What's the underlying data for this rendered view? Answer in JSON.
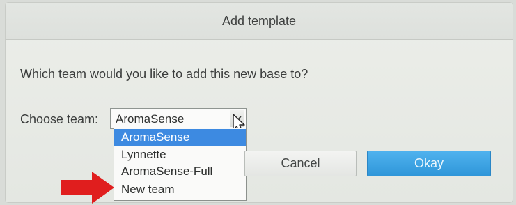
{
  "dialog": {
    "title": "Add template",
    "question": "Which team would you like to add this new base to?",
    "choose_label": "Choose team:",
    "selected_team": "AromaSense",
    "options": [
      "AromaSense",
      "Lynnette",
      "AromaSense-Full",
      "New team"
    ],
    "highlighted_option_index": 0,
    "cancel_label": "Cancel",
    "okay_label": "Okay"
  },
  "colors": {
    "highlight": "#3d8ae1",
    "okay_button": "#3aa3e4",
    "annotation_arrow": "#e01e1e"
  },
  "icons": {
    "dropdown": "chevron-down-icon",
    "cursor": "mouse-pointer-icon",
    "annotation": "red-arrow-icon"
  }
}
